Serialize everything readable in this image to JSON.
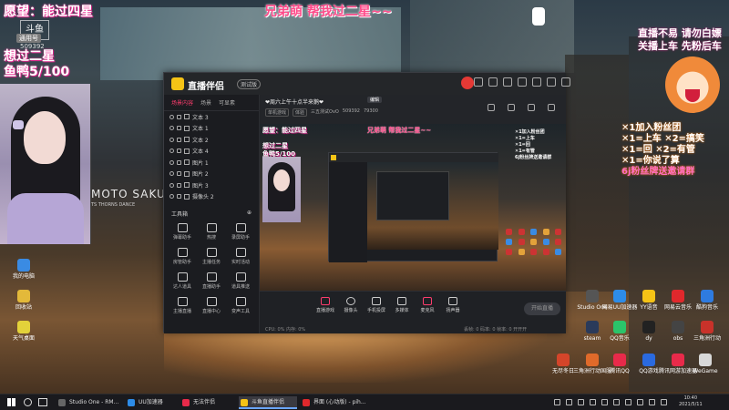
{
  "overlays": {
    "top_left": "愿望：能过四星",
    "top_center": "兄弟萌 帮我过二星~~",
    "left_line1": "想过二星",
    "left_line2": "鱼鸭5/100",
    "top_right_line1": "直播不易 请勿白嫖",
    "top_right_line2": "关播上车 先粉后车",
    "watermark": "斗鱼",
    "fan_badge": "通用号",
    "fan_number": "509392",
    "moto_text": "MOTO SAKURA",
    "moto_sub": "TS THORNS DANCE",
    "right_list": [
      "✕1加入粉丝团",
      "✕1=上车   ✕2=搞笑",
      "✕1=回   ✕2=有管",
      "✕1=你说了算",
      "6j粉丝牌送邀请群"
    ]
  },
  "app": {
    "brand": "直播伴侣",
    "beta": "测试版",
    "left_tabs": [
      "场景内容",
      "场景",
      "可显素"
    ],
    "scene_items": [
      "文本 3",
      "文本 1",
      "文本 2",
      "文本 4",
      "图片 1",
      "图片 2",
      "图片 3",
      "摄像头 2"
    ],
    "tools_title": "工具箱",
    "tools": [
      "弹幕助手",
      "热搜",
      "录屏助手",
      "房管助手",
      "主播任务",
      "实时活动",
      "达人道具",
      "直播助手",
      "道具推送",
      "主播直播",
      "直播中心",
      "变声工具"
    ],
    "stream_title": "❤周六上午十点半来鹅❤",
    "edit_tag": "编辑",
    "tags": [
      "单机游戏",
      "体验",
      "三五测试OvO",
      "509392",
      "79300"
    ],
    "controls": [
      "直播游戏",
      "摄像头",
      "手机投屏",
      "多媒体",
      "麦克风",
      "扬声器"
    ],
    "start_button": "开始直播",
    "status_left": "CPU: 0%   内存: 0%",
    "status_right": "丢帧: 0   码率: 0   帧率: 0   开开开",
    "preview": {
      "ov1": "愿望：能过四星",
      "ov2": "兄弟萌 帮我过二星~~",
      "ov3_line1": "想过二星",
      "ov3_line2": "鱼鸭5/100",
      "right_text": [
        "✕1加入粉丝团",
        "✕1=上车",
        "✕1=回",
        "✕1=有管",
        "6j粉丝牌送邀请群"
      ]
    }
  },
  "desktop_icons": {
    "left": [
      "我的电脑",
      "回收站",
      "天气桌面"
    ],
    "right": [
      "Studio One",
      "网易UU加速器",
      "YY语音",
      "网易云音乐",
      "酷狗音乐",
      "steam",
      "QQ音乐",
      "dy",
      "obs",
      "三角洲行动",
      "无尽冬日",
      "三角洲行动国服",
      "腾讯QQ",
      "QQ游戏",
      "腾讯网游加速器",
      "WeGame"
    ]
  },
  "taskbar": {
    "apps": [
      "Studio One - RM...",
      "UU加速器",
      "无法伴侣",
      "斗鱼直播伴侣",
      "界面 (心动版) - pih..."
    ],
    "clock_time": "10:40",
    "clock_date": "2021/5/11"
  }
}
